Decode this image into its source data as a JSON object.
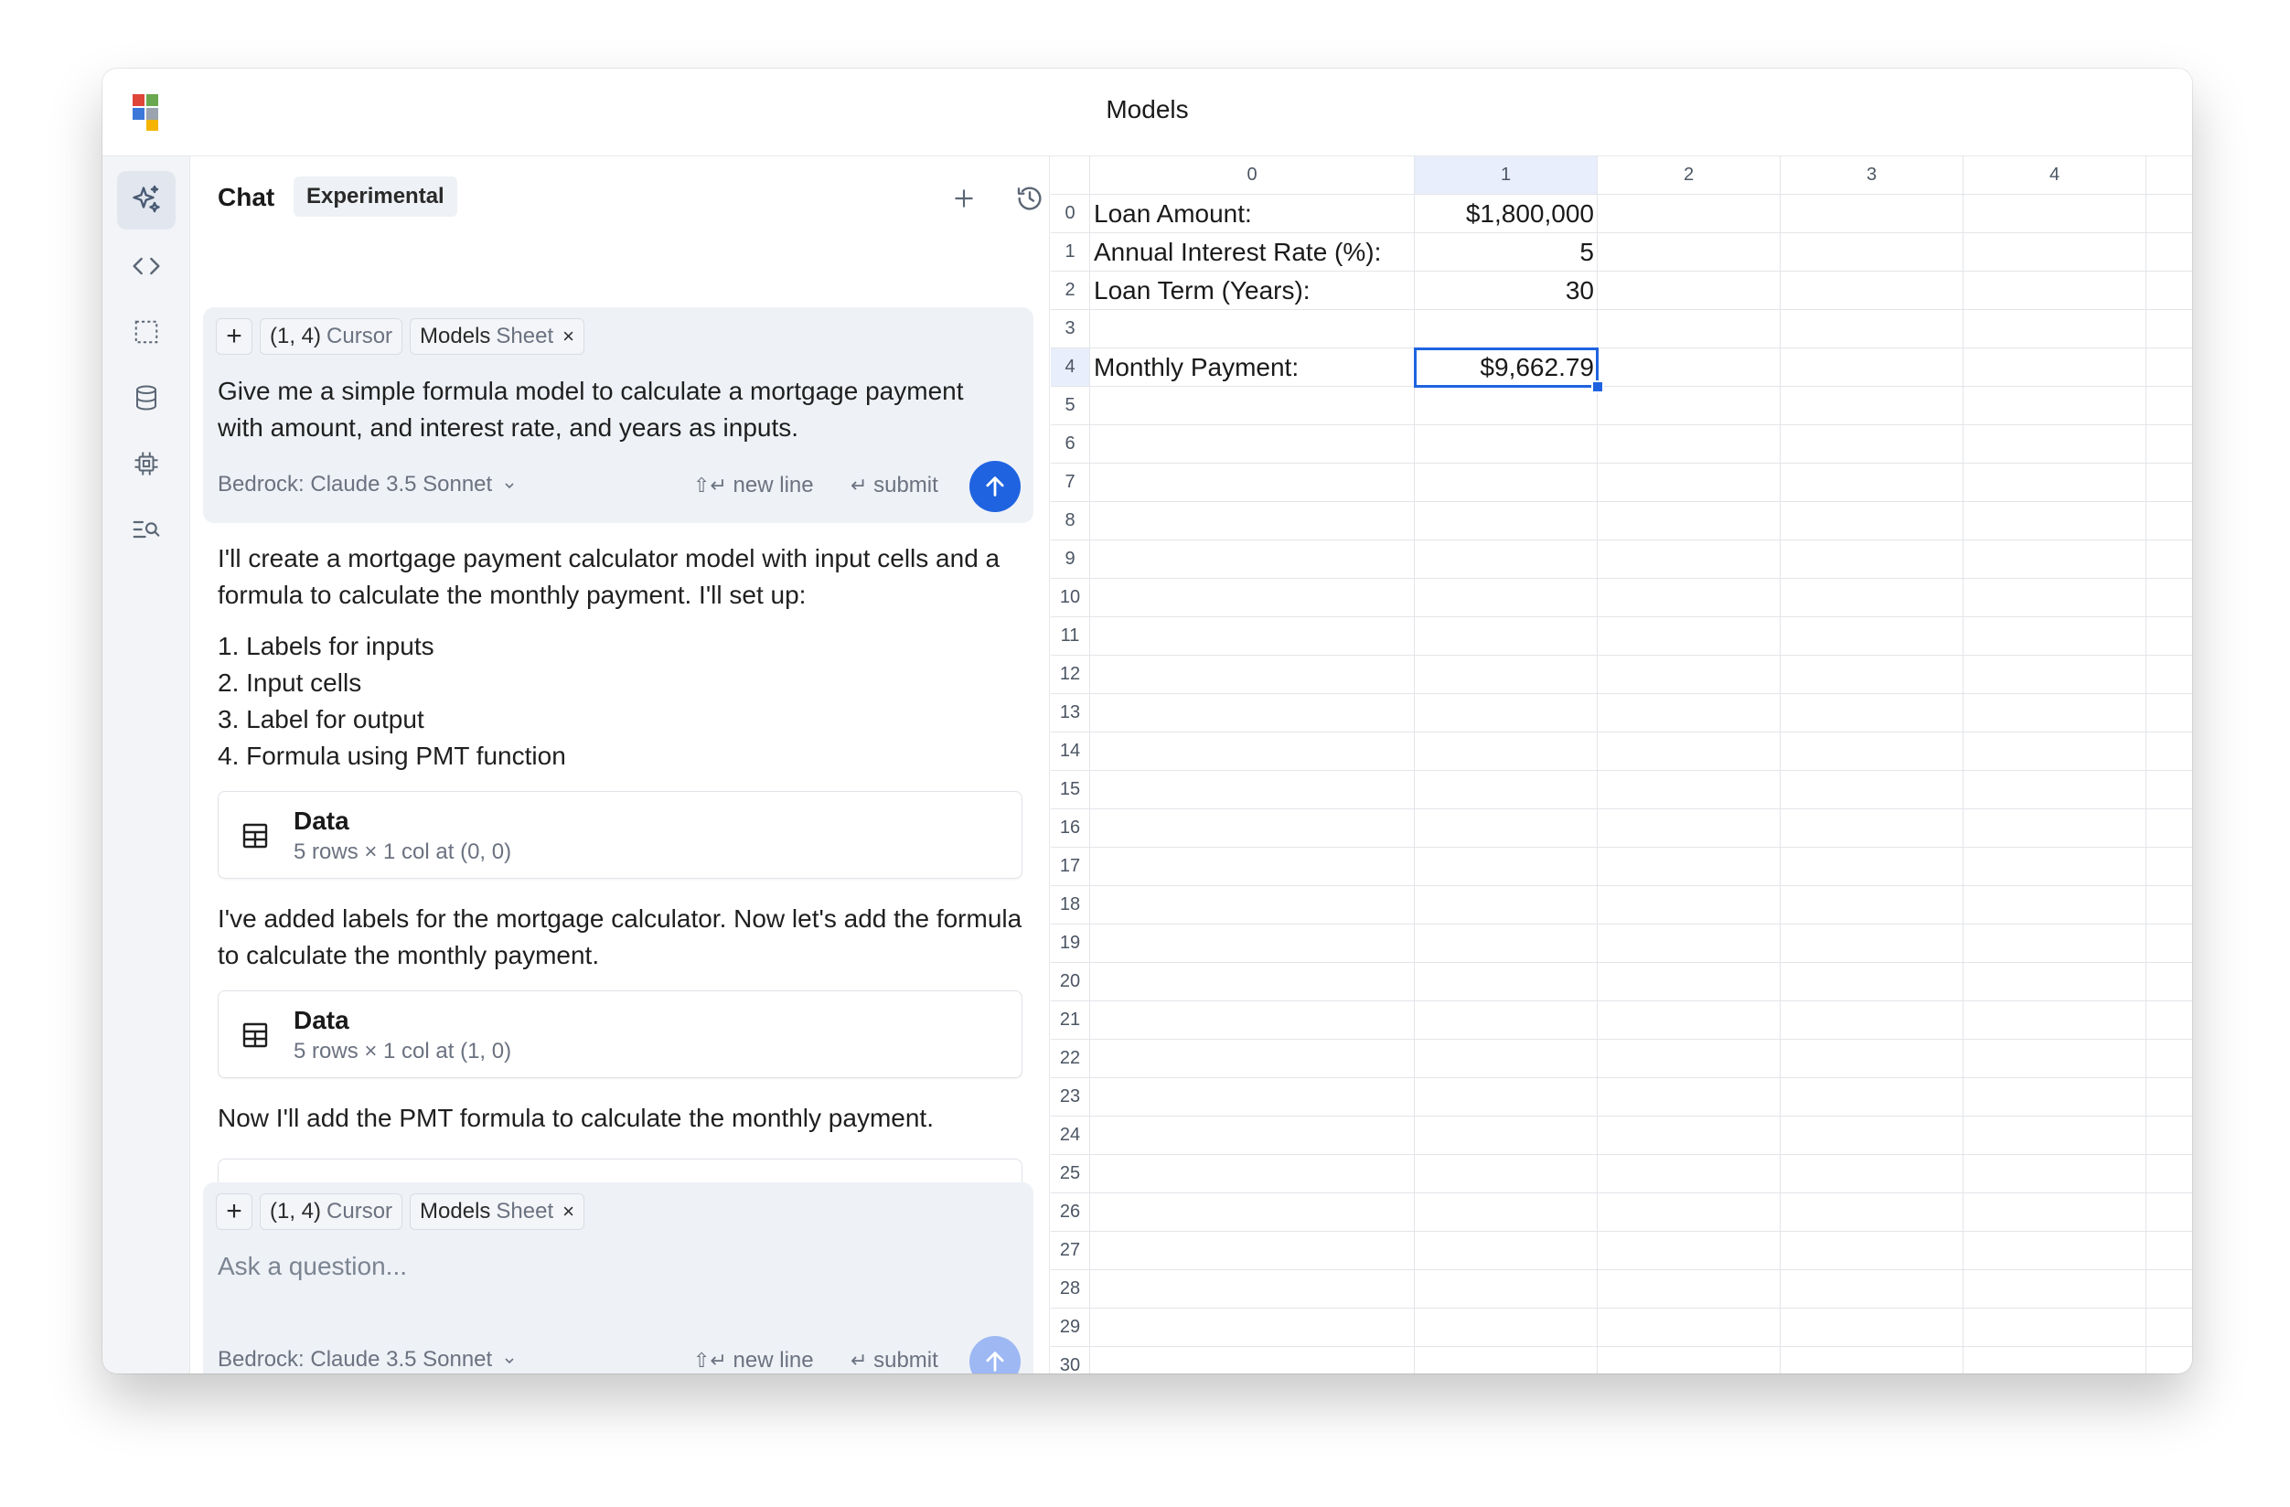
{
  "window": {
    "title": "Models"
  },
  "logo_colors": [
    "#e0453a",
    "#6aa84f",
    "#3d78d8",
    "#f4b400"
  ],
  "rail": {
    "icons": [
      "sparkle-icon",
      "code-icon",
      "selection-icon",
      "database-icon",
      "chip-icon",
      "search-list-icon"
    ]
  },
  "chat": {
    "title": "Chat",
    "badge": "Experimental",
    "header_icons": [
      "plus-icon",
      "history-icon",
      "close-icon"
    ],
    "top_input": {
      "chips": {
        "plus": "+",
        "cursor_pos": "(1, 4)",
        "cursor_label": "Cursor",
        "sheet_name": "Models",
        "sheet_label": "Sheet",
        "remove": "×"
      },
      "text": "Give me a simple formula model to calculate a mortgage payment with amount, and interest rate, and years as inputs.",
      "model": "Bedrock: Claude 3.5 Sonnet",
      "hint_newline": "new line",
      "hint_submit": "submit"
    },
    "messages": {
      "intro": "I'll create a mortgage payment calculator model with input cells and a formula to calculate the monthly payment. I'll set up:",
      "list": [
        "1. Labels for inputs",
        "2. Input cells",
        "3. Label for output",
        "4. Formula using PMT function"
      ],
      "tool1": {
        "name": "Data",
        "detail": "5 rows × 1 col at (0, 0)"
      },
      "msg2": "I've added labels for the mortgage calculator. Now let's add the formula to calculate the monthly payment.",
      "tool2": {
        "name": "Data",
        "detail": "5 rows × 1 col at (1, 0)"
      },
      "msg3": "Now I'll add the PMT formula to calculate the monthly payment."
    },
    "bottom_input": {
      "chips": {
        "plus": "+",
        "cursor_pos": "(1, 4)",
        "cursor_label": "Cursor",
        "sheet_name": "Models",
        "sheet_label": "Sheet",
        "remove": "×"
      },
      "placeholder": "Ask a question...",
      "model": "Bedrock: Claude 3.5 Sonnet",
      "hint_newline": "new line",
      "hint_submit": "submit"
    }
  },
  "sheet": {
    "columns": [
      "0",
      "1",
      "2",
      "3",
      "4"
    ],
    "rows": [
      "0",
      "1",
      "2",
      "3",
      "4",
      "5",
      "6",
      "7",
      "8",
      "9",
      "10",
      "11",
      "12",
      "13",
      "14",
      "15",
      "16",
      "17",
      "18",
      "19",
      "20",
      "21",
      "22",
      "23",
      "24",
      "25",
      "26",
      "27",
      "28",
      "29",
      "30"
    ],
    "selected_col": "1",
    "selected_row": "4",
    "cells": {
      "a0": "Loan Amount:",
      "b0": "$1,800,000",
      "a1": "Annual Interest Rate (%):",
      "b1": "5",
      "a2": "Loan Term (Years):",
      "b2": "30",
      "a4": "Monthly Payment:",
      "b4": "$9,662.79"
    },
    "accent": "#1f63e0"
  }
}
